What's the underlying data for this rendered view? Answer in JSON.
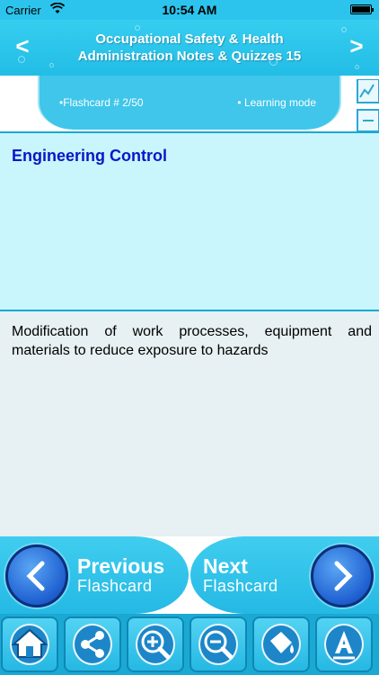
{
  "status_bar": {
    "carrier": "Carrier",
    "time": "10:54 AM"
  },
  "header": {
    "title_line1": "Occupational Safety & Health",
    "title_line2": "Administration Notes & Quizzes 15",
    "prev_icon": "chevron-left-icon",
    "next_icon": "chevron-right-icon"
  },
  "info": {
    "flashcard_counter": "•Flashcard #  2/50",
    "mode": "• Learning mode"
  },
  "card": {
    "term": "Engineering Control",
    "definition": "Modification of work processes, equipment and materials to reduce exposure to hazards"
  },
  "flash_nav": {
    "prev_title": "Previous",
    "prev_sub": "Flashcard",
    "next_title": "Next",
    "next_sub": "Flashcard"
  },
  "toolbar": {
    "icons": [
      "home-icon",
      "share-icon",
      "zoom-in-icon",
      "zoom-out-icon",
      "paint-bucket-icon",
      "font-icon"
    ]
  },
  "colors": {
    "header": "#2cc4ec",
    "term_text": "#0a16c7",
    "question_bg": "#c8f6fc",
    "answer_bg": "#e7f0f2"
  }
}
